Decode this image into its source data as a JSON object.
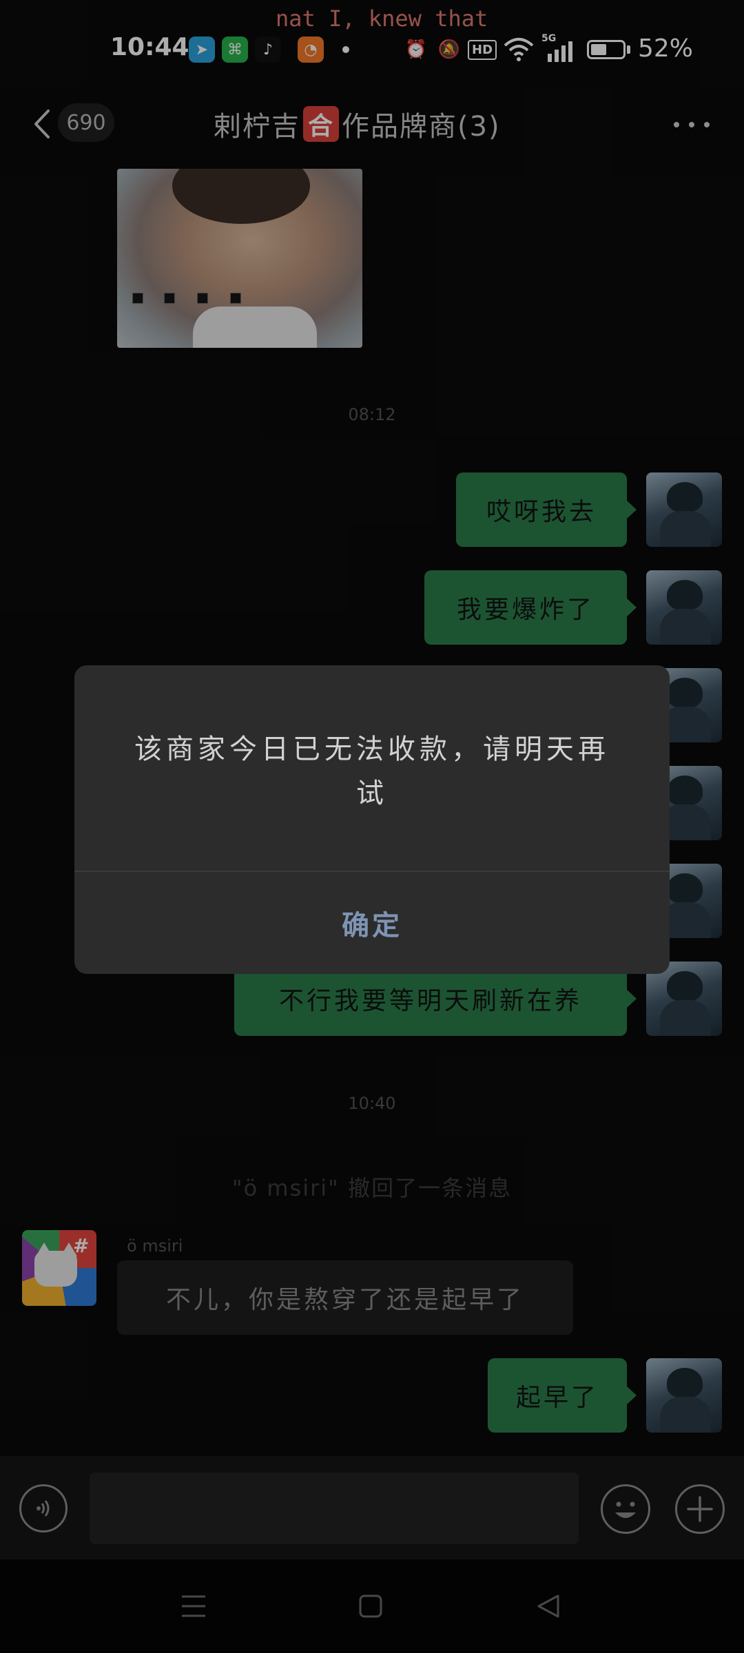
{
  "status_bar": {
    "lyric_text": "nat I, knew that",
    "time": "10:44",
    "network_label": "5G",
    "hd_label": "HD",
    "battery_percent": "52%",
    "notification_apps": [
      "telegram-icon",
      "wechat-mini-icon",
      "tiktok-icon",
      "browser-icon"
    ]
  },
  "header": {
    "unread_count": "690",
    "title_before": "剌柠吉",
    "title_badge": "合",
    "title_after": "作品牌商(3)"
  },
  "messages": {
    "ts_0812": "08:12",
    "out_1": "哎呀我去",
    "out_2": "我要爆炸了",
    "out_last_partial": "不行我要等明天刷新在养",
    "ts_1040": "10:40",
    "recall_notice": "\"ö msiri\" 撤回了一条消息",
    "sender_name": "ö msiri",
    "in_1": "不儿，你是熬穿了还是起早了",
    "out_final": "起早了"
  },
  "input": {
    "value": ""
  },
  "dialog": {
    "message": "该商家今日已无法收款，请明天再试",
    "confirm_label": "确定"
  },
  "colors": {
    "background": "#0a0a0a",
    "outgoing_bubble": "#2a7c4a",
    "incoming_bubble": "#1e1e1e",
    "dialog_bg": "#2c2c2c",
    "dialog_button_text": "#7f94b4",
    "title_badge": "#d9423a"
  }
}
